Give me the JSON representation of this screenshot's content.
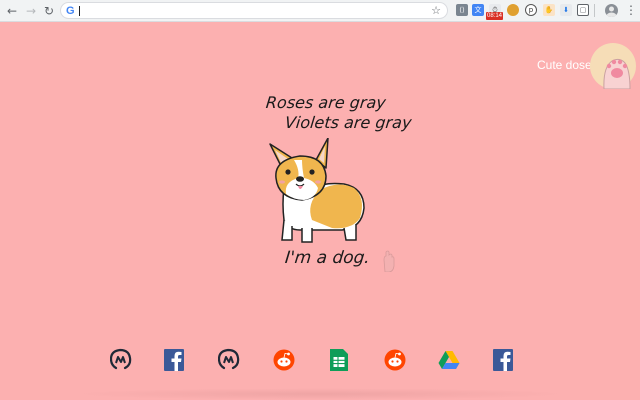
{
  "browser": {
    "omnibox": {
      "value": ""
    },
    "extensions": [
      {
        "icon": "code-extension-icon"
      },
      {
        "icon": "translate-extension-icon"
      },
      {
        "icon": "timer-extension-icon",
        "badge": "08:14"
      },
      {
        "icon": "cookie-extension-icon"
      },
      {
        "icon": "pinterest-extension-icon"
      },
      {
        "icon": "hand-extension-icon"
      },
      {
        "icon": "download-extension-icon"
      },
      {
        "icon": "screen-extension-icon"
      },
      {
        "icon": "puzzle-extension-icon"
      }
    ],
    "badge_text": "08:14"
  },
  "page": {
    "cute_dose_label": "Cute dose",
    "poem": {
      "line1": "Roses are gray",
      "line2": "Violets are gray",
      "line3": "I'm a dog."
    },
    "background_color": "#fcb0b0"
  },
  "dock": [
    {
      "name": "coinmarketcap",
      "icon": "coinmarketcap-icon"
    },
    {
      "name": "facebook",
      "icon": "facebook-icon"
    },
    {
      "name": "coinmarketcap",
      "icon": "coinmarketcap-icon"
    },
    {
      "name": "reddit",
      "icon": "reddit-icon"
    },
    {
      "name": "google-sheets",
      "icon": "google-sheets-icon"
    },
    {
      "name": "reddit",
      "icon": "reddit-icon"
    },
    {
      "name": "google-drive",
      "icon": "google-drive-icon"
    },
    {
      "name": "facebook",
      "icon": "facebook-icon"
    }
  ]
}
